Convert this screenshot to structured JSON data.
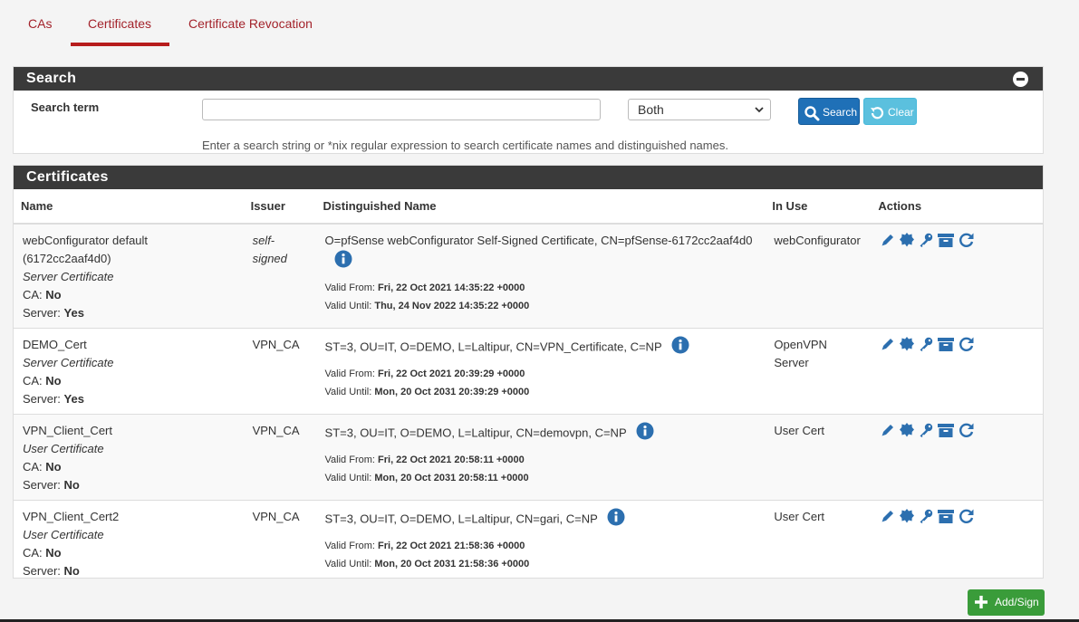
{
  "tabs": [
    {
      "label": "CAs"
    },
    {
      "label": "Certificates"
    },
    {
      "label": "Certificate Revocation"
    }
  ],
  "search": {
    "title": "Search",
    "label": "Search term",
    "value": "",
    "placeholder": "",
    "scope_selected": "Both",
    "search_button": "Search",
    "clear_button": "Clear",
    "help": "Enter a search string or *nix regular expression to search certificate names and distinguished names."
  },
  "certificates": {
    "title": "Certificates",
    "columns": [
      "Name",
      "Issuer",
      "Distinguished Name",
      "In Use",
      "Actions"
    ],
    "rows": [
      {
        "name": "webConfigurator default (6172cc2aaf4d0)",
        "type": "Server Certificate",
        "ca_label": "CA:",
        "ca": "No",
        "server_label": "Server:",
        "server": "Yes",
        "issuer": "self-signed",
        "dn": "O=pfSense webConfigurator Self-Signed Certificate, CN=pfSense-6172cc2aaf4d0",
        "valid_from_label": "Valid From:",
        "valid_from": "Fri, 22 Oct 2021 14:35:22 +0000",
        "valid_until_label": "Valid Until:",
        "valid_until": "Thu, 24 Nov 2022 14:35:22 +0000",
        "in_use": "webConfigurator"
      },
      {
        "name": "DEMO_Cert",
        "type": "Server Certificate",
        "ca_label": "CA:",
        "ca": "No",
        "server_label": "Server:",
        "server": "Yes",
        "issuer": "VPN_CA",
        "dn": "ST=3, OU=IT, O=DEMO, L=Laltipur, CN=VPN_Certificate, C=NP",
        "valid_from_label": "Valid From:",
        "valid_from": "Fri, 22 Oct 2021 20:39:29 +0000",
        "valid_until_label": "Valid Until:",
        "valid_until": "Mon, 20 Oct 2031 20:39:29 +0000",
        "in_use": "OpenVPN Server"
      },
      {
        "name": "VPN_Client_Cert",
        "type": "User Certificate",
        "ca_label": "CA:",
        "ca": "No",
        "server_label": "Server:",
        "server": "No",
        "issuer": "VPN_CA",
        "dn": "ST=3, OU=IT, O=DEMO, L=Laltipur, CN=demovpn, C=NP",
        "valid_from_label": "Valid From:",
        "valid_from": "Fri, 22 Oct 2021 20:58:11 +0000",
        "valid_until_label": "Valid Until:",
        "valid_until": "Mon, 20 Oct 2031 20:58:11 +0000",
        "in_use": "User Cert"
      },
      {
        "name": "VPN_Client_Cert2",
        "type": "User Certificate",
        "ca_label": "CA:",
        "ca": "No",
        "server_label": "Server:",
        "server": "No",
        "issuer": "VPN_CA",
        "dn": "ST=3, OU=IT, O=DEMO, L=Laltipur, CN=gari, C=NP",
        "valid_from_label": "Valid From:",
        "valid_from": "Fri, 22 Oct 2021 21:58:36 +0000",
        "valid_until_label": "Valid Until:",
        "valid_until": "Mon, 20 Oct 2031 21:58:36 +0000",
        "in_use": "User Cert"
      }
    ],
    "action_icons": [
      "pencil-icon",
      "certificate-icon",
      "key-icon",
      "archive-icon",
      "refresh-icon"
    ]
  },
  "add_button": "Add/Sign",
  "colors": {
    "accent": "#a3232b",
    "panel_header": "#3a3a3a",
    "primary": "#1f70b7",
    "info": "#5bc0de",
    "success": "#3a9c3a",
    "icon_blue": "#2c6faf"
  }
}
